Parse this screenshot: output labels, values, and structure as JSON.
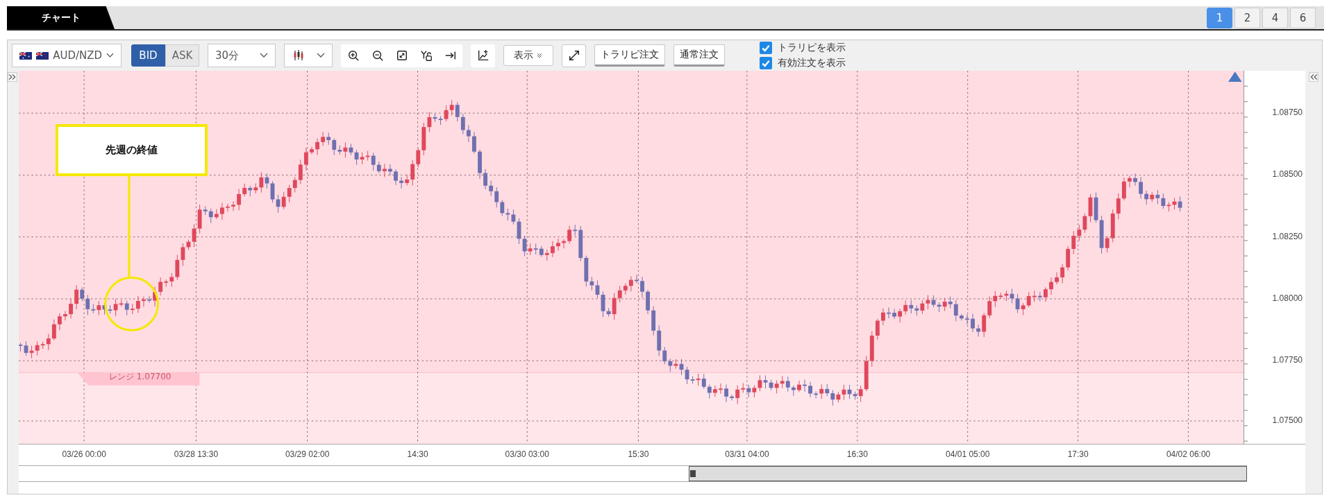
{
  "tab": {
    "label": "チャート"
  },
  "layouts": [
    {
      "label": "1",
      "selected": true
    },
    {
      "label": "2",
      "selected": false
    },
    {
      "label": "4",
      "selected": false
    },
    {
      "label": "6",
      "selected": false
    }
  ],
  "toolbar": {
    "symbol": "AUD/NZD",
    "price_side": [
      {
        "label": "BID",
        "selected": true
      },
      {
        "label": "ASK",
        "selected": false
      }
    ],
    "timeframe": "30分",
    "display_menu": "表示",
    "buttons": [
      "トラリピ注文",
      "通常注文"
    ],
    "options": [
      {
        "label": "トラリピを表示",
        "checked": true
      },
      {
        "label": "有効注文を表示",
        "checked": true
      }
    ]
  },
  "chart": {
    "callout": "先週の終値",
    "range_label": "レンジ 1.07700",
    "y_axis_labels": [
      "1.08750",
      "1.08500",
      "1.08250",
      "1.08000",
      "1.07750",
      "1.07500"
    ],
    "x_axis_labels": [
      "03/26 00:00",
      "03/28 13:30",
      "03/29 02:00",
      "14:30",
      "03/30 03:00",
      "15:30",
      "03/31 04:00",
      "16:30",
      "04/01 05:00",
      "17:30",
      "04/02 06:00"
    ]
  }
}
